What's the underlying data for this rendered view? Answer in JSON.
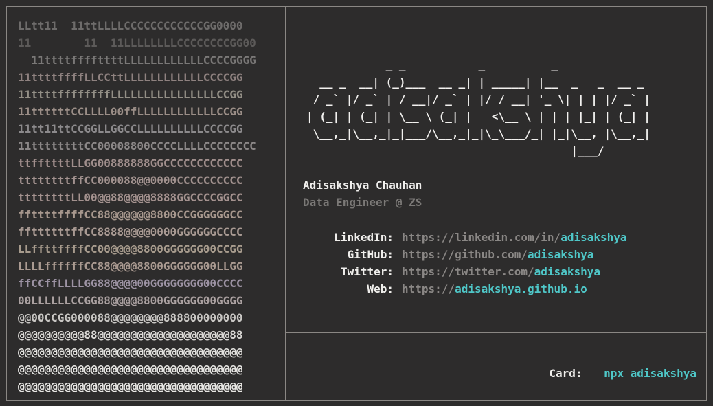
{
  "portrait": {
    "lines": [
      "LLtt11  11ttLLLLCCCCCCCCCCCCGG0000",
      "11        11  11LLLLLLLLCCCCCCCCGG00",
      "  11ttttffffttttLLLLLLLLLLLLCCCCGGGG",
      "11ttttffffLLCCttLLLLLLLLLLLLCCCCGG",
      "11ttttffffffffLLLLLLLLLLLLLLLLCCGG",
      "11ttttttCCLLLL00ffLLLLLLLLLLLLCCGG",
      "11tt11ttCCGGLLGGCCLLLLLLLLLLCCCCGG",
      "11ttttttttCC00008800CCCCLLLLCCCCCCCC",
      "ttffttttLLGG00888888GGCCCCCCCCCCCC",
      "ttttttttffCC000088@@0000CCCCCCCCCC",
      "ttttttttLL00@@88@@@@8888GGCCCCGGCC",
      "ffttttffffCC88@@@@@@8800CCGGGGGGCC",
      "ffttttttffCC8888@@@@0000GGGGGGCCCC",
      "LLffttffffCC00@@@@8800GGGGGG00CCGG",
      "LLLLffffffCC88@@@@8800GGGGGG00LLGG",
      "ffCCffLLLLGG88@@@@00GGGGGGGG00CCCC",
      "00LLLLLLCCGG88@@@@8800GGGGGG00GGGG",
      "@@00CCGG000088@@@@@@@@888800000000",
      "@@@@@@@@@@88@@@@@@@@@@@@@@@@@@@@88",
      "@@@@@@@@@@@@@@@@@@@@@@@@@@@@@@@@@@",
      "@@@@@@@@@@@@@@@@@@@@@@@@@@@@@@@@@@",
      "@@@@@@@@@@@@@@@@@@@@@@@@@@@@@@@@@@"
    ],
    "colors": [
      "#6e6c6b",
      "#5c5a59",
      "#7a7877",
      "#8f8280",
      "#938f86",
      "#9b8e87",
      "#8c8a8c",
      "#8b8787",
      "#a08e8c",
      "#a2928f",
      "#a4928f",
      "#a8988e",
      "#a99a93",
      "#a79b8d",
      "#aa9a91",
      "#9d93a4",
      "#aba1a1",
      "#c9c7c4",
      "#dad8d5",
      "#e3e2df",
      "#e6e5e2",
      "#e8e7e4"
    ]
  },
  "logo_ascii": "            _ _           _          _\n  __ _  __| (_)___  __ _| | _____| |__  _   _  __ _\n / _` |/ _` | / __|/ _` | |/ / __| '_ \\| | | |/ _` |\n| (_| | (_| | \\__ \\ (_| |   <\\__ \\ | | | |_| | (_| |\n \\__,_|\\__,_|_|___/\\__,_|_|\\_\\___/_| |_|\\__, |\\__,_|\n                                        |___/",
  "profile": {
    "name": "Adisakshya Chauhan",
    "role": "Data Engineer @ ZS"
  },
  "links": [
    {
      "label": "LinkedIn:",
      "base": "https://linkedin.com/in/",
      "handle": "adisakshya"
    },
    {
      "label": "GitHub:",
      "base": "https://github.com/",
      "handle": "adisakshya"
    },
    {
      "label": "Twitter:",
      "base": "https://twitter.com/",
      "handle": "adisakshya"
    },
    {
      "label": "Web:",
      "base": "https://",
      "handle": "adisakshya.github.io"
    }
  ],
  "card": {
    "label": "Card:",
    "command": "npx adisakshya"
  },
  "colors": {
    "background": "#2d2c2c",
    "border": "#8a8784",
    "accent": "#4fc7c8",
    "muted": "#8a8785"
  }
}
